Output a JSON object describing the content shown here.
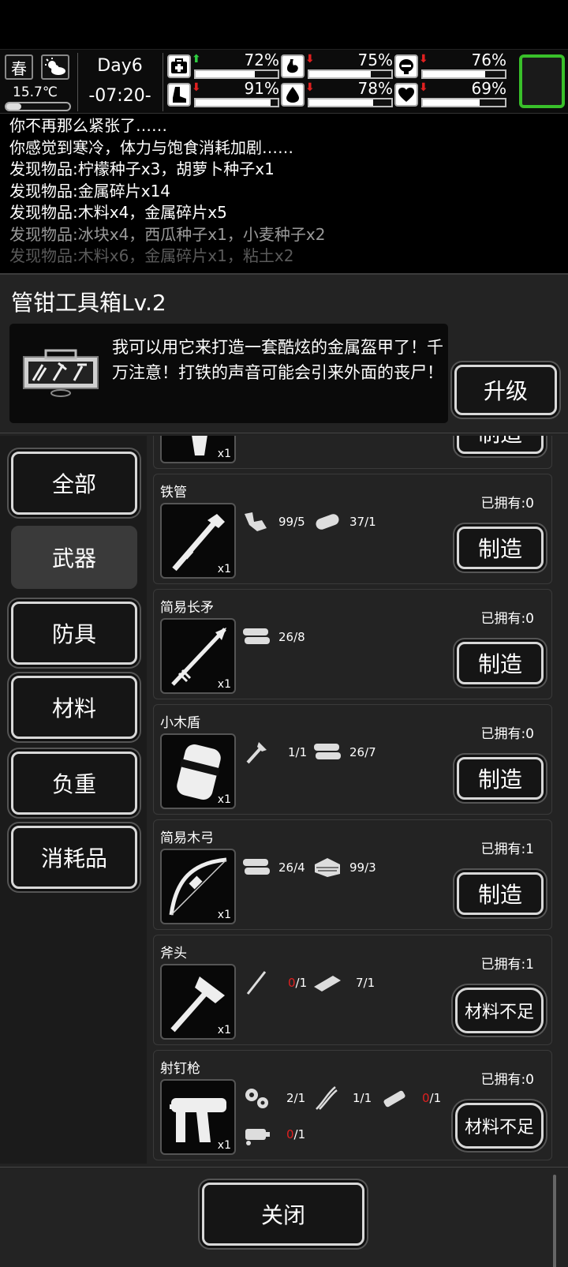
{
  "status": {
    "season": "春",
    "temperature": "15.7℃",
    "day": "Day6",
    "time": "-07:20-",
    "stats": [
      {
        "icon": "medkit-icon",
        "trend": "up",
        "value": "72%",
        "level": 0.72
      },
      {
        "icon": "stomach-icon",
        "trend": "down",
        "value": "75%",
        "level": 0.75
      },
      {
        "icon": "brain-icon",
        "trend": "down",
        "value": "76%",
        "level": 0.76
      },
      {
        "icon": "foot-icon",
        "trend": "down",
        "value": "91%",
        "level": 0.91
      },
      {
        "icon": "water-drop-icon",
        "trend": "down",
        "value": "78%",
        "level": 0.78
      },
      {
        "icon": "heart-icon",
        "trend": "down",
        "value": "69%",
        "level": 0.69
      }
    ]
  },
  "log": [
    "你不再那么紧张了……",
    "你感觉到寒冷，体力与饱食消耗加剧……",
    "发现物品:柠檬种子x3，胡萝卜种子x1",
    "发现物品:金属碎片x14",
    "发现物品:木料x4，金属碎片x5",
    "发现物品:冰块x4，西瓜种子x1，小麦种子x2",
    "发现物品:木料x6，金属碎片x1，粘土x2"
  ],
  "panel": {
    "title": "管钳工具箱Lv.2",
    "description": "我可以用它来打造一套酷炫的金属盔甲了！千万注意！打铁的声音可能会引来外面的丧尸！",
    "upgrade_label": "升级",
    "close_label": "关闭"
  },
  "tabs": [
    "全部",
    "武器",
    "防具",
    "材料",
    "负重",
    "消耗品"
  ],
  "partial_item": {
    "qty": "x1",
    "button": "制造"
  },
  "items": [
    {
      "name": "铁管",
      "icon": "iron-pipe-icon",
      "qty": "x1",
      "owned": "已拥有:0",
      "materials": [
        {
          "icon": "metal-scrap-icon",
          "have": "99",
          "need": "/5",
          "short": false
        },
        {
          "icon": "wood-log-icon",
          "have": "37",
          "need": "/1",
          "short": false
        }
      ],
      "button": "制造",
      "craftable": true
    },
    {
      "name": "简易长矛",
      "icon": "spear-icon",
      "qty": "x1",
      "owned": "已拥有:0",
      "materials": [
        {
          "icon": "wood-log-icon",
          "have": "26",
          "need": "/8",
          "short": false
        }
      ],
      "button": "制造",
      "craftable": true
    },
    {
      "name": "小木盾",
      "icon": "shield-icon",
      "qty": "x1",
      "owned": "已拥有:0",
      "materials": [
        {
          "icon": "screw-icon",
          "have": "1",
          "need": "/1",
          "short": false
        },
        {
          "icon": "wood-log-icon",
          "have": "26",
          "need": "/7",
          "short": false
        }
      ],
      "button": "制造",
      "craftable": true
    },
    {
      "name": "简易木弓",
      "icon": "bow-icon",
      "qty": "x1",
      "owned": "已拥有:1",
      "materials": [
        {
          "icon": "wood-log-icon",
          "have": "26",
          "need": "/4",
          "short": false
        },
        {
          "icon": "cloth-icon",
          "have": "99",
          "need": "/3",
          "short": false
        }
      ],
      "button": "制造",
      "craftable": true
    },
    {
      "name": "斧头",
      "icon": "axe-icon",
      "qty": "x1",
      "owned": "已拥有:1",
      "materials": [
        {
          "icon": "stick-icon",
          "have": "0",
          "need": "/1",
          "short": true
        },
        {
          "icon": "whetstone-icon",
          "have": "7",
          "need": "/1",
          "short": false
        }
      ],
      "button": "材料不足",
      "craftable": false
    },
    {
      "name": "射钉枪",
      "icon": "nail-gun-icon",
      "qty": "x1",
      "owned": "已拥有:0",
      "materials": [
        {
          "icon": "gears-icon",
          "have": "2",
          "need": "/1",
          "short": false
        },
        {
          "icon": "wires-icon",
          "have": "1",
          "need": "/1",
          "short": false
        },
        {
          "icon": "battery-icon",
          "have": "0",
          "need": "/1",
          "short": true
        },
        {
          "icon": "motor-icon",
          "have": "0",
          "need": "/1",
          "short": true
        }
      ],
      "button": "材料不足",
      "craftable": false
    }
  ],
  "colors": {
    "accent_green": "#39c02a",
    "shortage_red": "#e02020",
    "trend_up": "#2ecc40",
    "trend_down": "#e02020"
  }
}
